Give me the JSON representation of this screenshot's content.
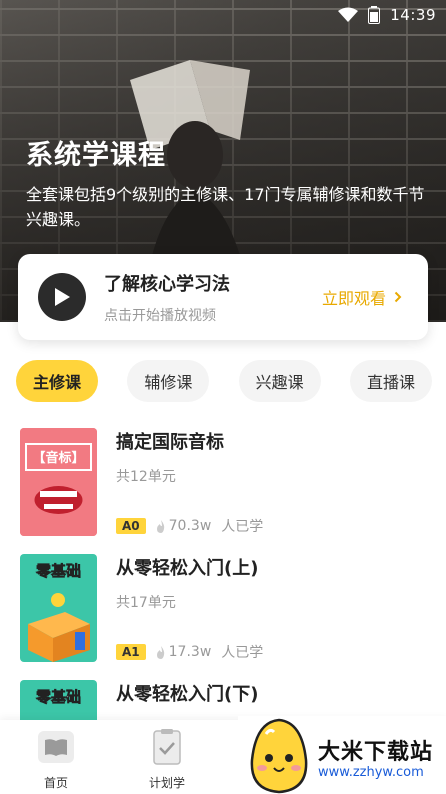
{
  "status_bar": {
    "time": "14:39"
  },
  "hero": {
    "title": "系统学课程",
    "description": "全套课包括9个级别的主修课、17门专属辅修课和数千节兴趣课。"
  },
  "intro_card": {
    "title": "了解核心学习法",
    "subtitle": "点击开始播放视频",
    "action": "立即观看"
  },
  "tabs": [
    {
      "label": "主修课",
      "active": true
    },
    {
      "label": "辅修课",
      "active": false
    },
    {
      "label": "兴趣课",
      "active": false
    },
    {
      "label": "直播课",
      "active": false
    }
  ],
  "courses": [
    {
      "title": "搞定国际音标",
      "units": "共12单元",
      "level": "A0",
      "views": "70.3w",
      "learners_label": "人已学",
      "thumb_text": "【音标】"
    },
    {
      "title": "从零轻松入门(上)",
      "units": "共17单元",
      "level": "A1",
      "views": "17.3w",
      "learners_label": "人已学",
      "thumb_text": "零基础"
    },
    {
      "title": "从零轻松入门(下)",
      "units": "",
      "level": "",
      "views": "",
      "learners_label": "",
      "thumb_text": "零基础"
    }
  ],
  "bottom_nav": {
    "items": [
      {
        "label": "首页",
        "icon": "book-icon"
      },
      {
        "label": "计划学",
        "icon": "clipboard-check-icon"
      }
    ]
  },
  "watermark": {
    "text": "大米下载站",
    "url": "www.zzhyw.com"
  },
  "colors": {
    "accent": "#ffd43b",
    "action": "#e8a900",
    "dark": "#2b2b2b"
  }
}
